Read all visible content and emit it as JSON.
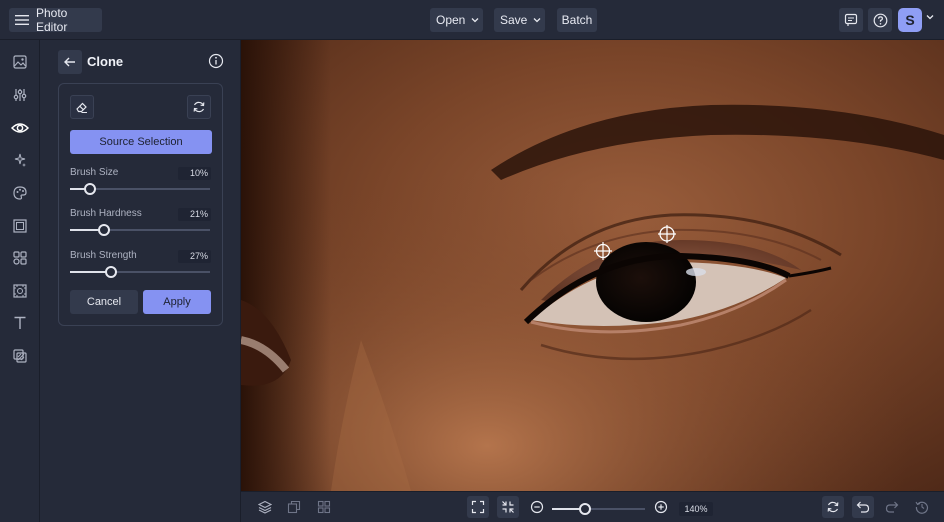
{
  "app": {
    "menu_label": "Photo Editor"
  },
  "toolbar": {
    "open_label": "Open",
    "save_label": "Save",
    "batch_label": "Batch"
  },
  "user": {
    "initial": "S"
  },
  "panel": {
    "title": "Clone",
    "source_selection_label": "Source Selection",
    "sliders": [
      {
        "label": "Brush Size",
        "value": "10%",
        "fraction": 0.14
      },
      {
        "label": "Brush Hardness",
        "value": "21%",
        "fraction": 0.24
      },
      {
        "label": "Brush Strength",
        "value": "27%",
        "fraction": 0.29
      }
    ],
    "cancel_label": "Cancel",
    "apply_label": "Apply"
  },
  "zoom": {
    "value": "140%",
    "fraction": 0.36
  },
  "colors": {
    "accent": "#8592f2",
    "panel_bg": "#252a39",
    "button_bg": "#333a4c"
  },
  "rail_icons": [
    "image-icon",
    "adjust-sliders-icon",
    "eye-icon",
    "magic-sparkle-icon",
    "palette-icon",
    "frame-icon",
    "shapes-icon",
    "texture-icon",
    "text-icon",
    "overlay-icon"
  ]
}
